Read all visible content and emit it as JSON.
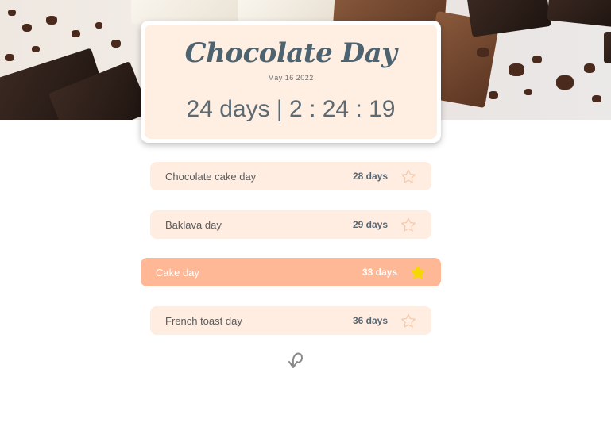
{
  "event": {
    "title": "Chocolate Day",
    "date": "May 16 2022",
    "countdown": "24 days | 2 : 24 : 19"
  },
  "list": [
    {
      "label": "Chocolate cake day",
      "days": "28 days",
      "favorite": false
    },
    {
      "label": "Baklava day",
      "days": "29 days",
      "favorite": false
    },
    {
      "label": "Cake day",
      "days": "33 days",
      "favorite": true
    },
    {
      "label": "French toast day",
      "days": "36 days",
      "favorite": false
    }
  ],
  "colors": {
    "card_bg": "#ffeee2",
    "row_bg": "#ffede1",
    "row_active_bg": "#ffb896",
    "title": "#4d6470",
    "star_outline": "#f4c7a8",
    "star_filled": "#f5d800"
  },
  "icons": {
    "favorite": "star-icon",
    "refresh": "refresh-icon",
    "hero": "chocolate-photo"
  }
}
